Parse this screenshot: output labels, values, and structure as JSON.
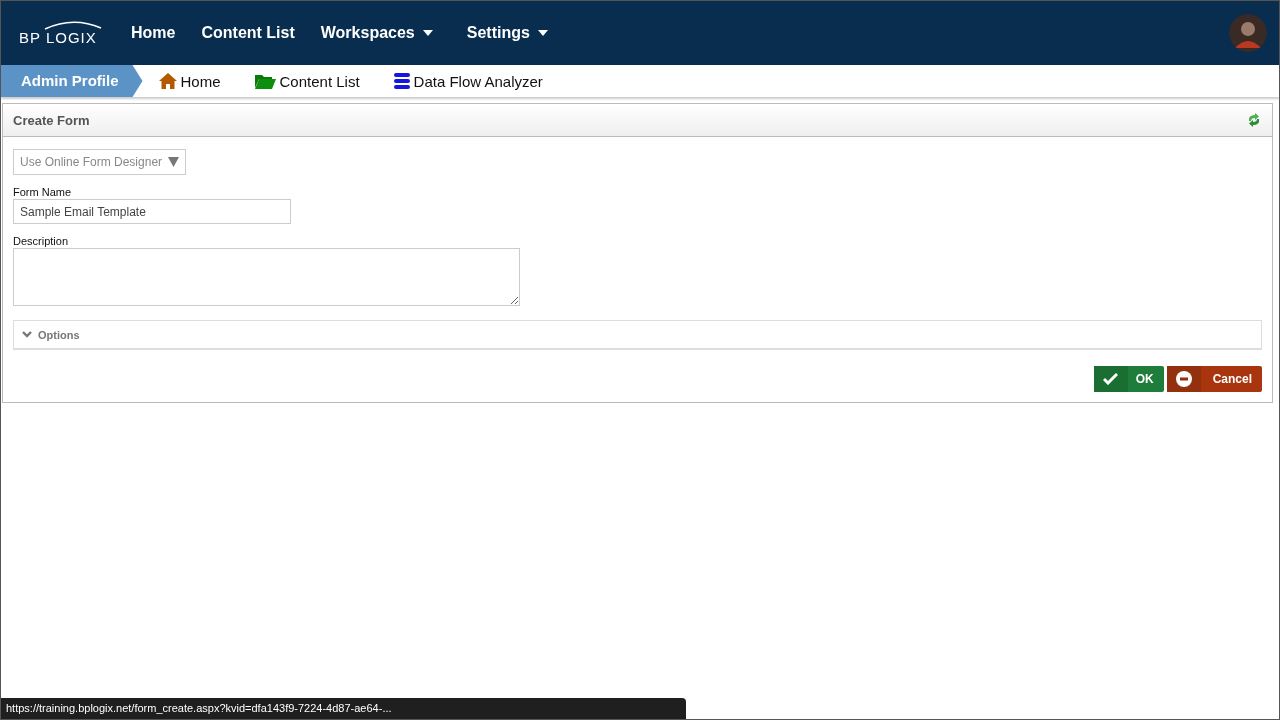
{
  "header": {
    "logo": "BP LOGIX",
    "nav": [
      {
        "label": "Home",
        "dropdown": false
      },
      {
        "label": "Content List",
        "dropdown": false
      },
      {
        "label": "Workspaces",
        "dropdown": true
      },
      {
        "label": "Settings",
        "dropdown": true
      }
    ]
  },
  "breadcrumb": {
    "current": "Admin Profile",
    "links": [
      {
        "label": "Home",
        "kind": "home"
      },
      {
        "label": "Content List",
        "kind": "folder"
      },
      {
        "label": "Data Flow Analyzer",
        "kind": "database"
      }
    ]
  },
  "panel": {
    "title": "Create Form",
    "designer_select": {
      "value": "Use Online Form Designer"
    },
    "form_name": {
      "label": "Form Name",
      "value": "Sample Email Template"
    },
    "description": {
      "label": "Description"
    },
    "options": {
      "label": "Options",
      "expanded": false
    },
    "buttons": [
      {
        "label": "OK",
        "kind": "ok"
      },
      {
        "label": "Cancel",
        "kind": "cancel"
      }
    ]
  },
  "status_bar": {
    "url": "https://training.bplogix.net/form_create.aspx?kvid=dfa143f9-7224-4d87-ae64-..."
  }
}
